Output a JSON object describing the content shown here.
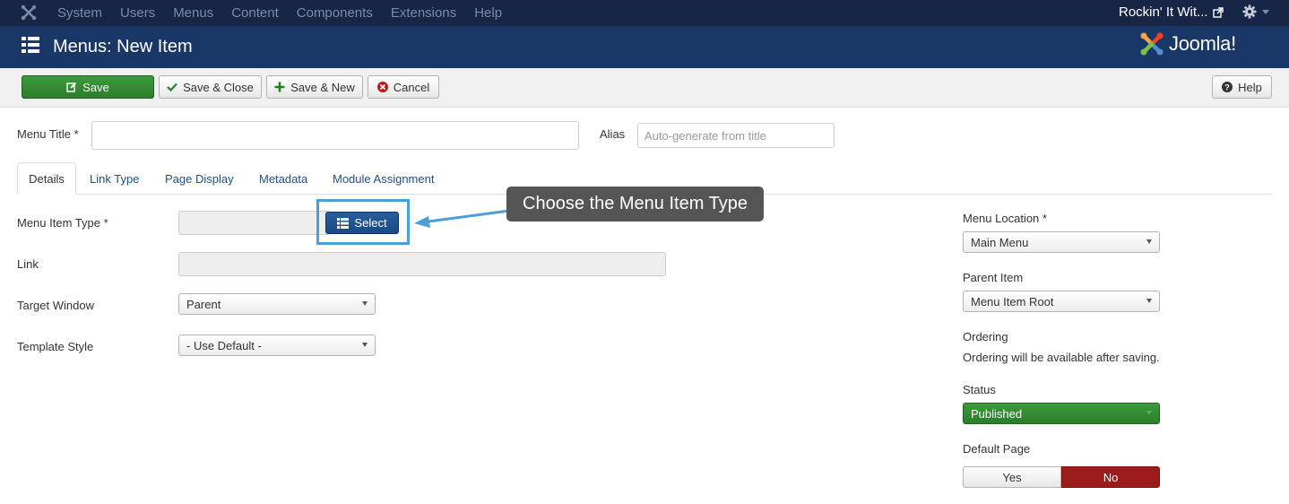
{
  "topnav": {
    "brand_icon": "joomla-icon",
    "items": [
      {
        "label": "System"
      },
      {
        "label": "Users"
      },
      {
        "label": "Menus"
      },
      {
        "label": "Content"
      },
      {
        "label": "Components"
      },
      {
        "label": "Extensions"
      },
      {
        "label": "Help"
      }
    ],
    "site_name": "Rockin' It Wit...",
    "external_icon": "external-link-icon",
    "settings_icon": "gear-icon"
  },
  "header": {
    "title": "Menus: New Item",
    "logo_text": "Joomla!"
  },
  "toolbar": {
    "save_label": "Save",
    "save_close_label": "Save & Close",
    "save_new_label": "Save & New",
    "cancel_label": "Cancel",
    "help_label": "Help"
  },
  "form": {
    "menu_title_label": "Menu Title *",
    "menu_title_value": "",
    "alias_label": "Alias",
    "alias_placeholder": "Auto-generate from title"
  },
  "tabs": [
    {
      "label": "Details",
      "active": true
    },
    {
      "label": "Link Type"
    },
    {
      "label": "Page Display"
    },
    {
      "label": "Metadata"
    },
    {
      "label": "Module Assignment"
    }
  ],
  "details": {
    "menu_item_type_label": "Menu Item Type *",
    "menu_item_type_value": "",
    "select_label": "Select",
    "link_label": "Link",
    "link_value": "",
    "target_window_label": "Target Window",
    "target_window_value": "Parent",
    "template_style_label": "Template Style",
    "template_style_value": "- Use Default -"
  },
  "callout": {
    "text": "Choose the Menu Item Type"
  },
  "sidebar": {
    "menu_location_label": "Menu Location *",
    "menu_location_value": "Main Menu",
    "parent_item_label": "Parent Item",
    "parent_item_value": "Menu Item Root",
    "ordering_label": "Ordering",
    "ordering_text": "Ordering will be available after saving.",
    "status_label": "Status",
    "status_value": "Published",
    "default_page_label": "Default Page",
    "default_yes": "Yes",
    "default_no": "No",
    "default_selected": "No"
  },
  "colors": {
    "topnav_bg": "#172547",
    "header_bg": "#1a3867",
    "save_green": "#2f8632",
    "select_blue": "#1e508e",
    "no_red": "#9c1c1c",
    "highlight_blue": "#4a9fd6",
    "callout_bg": "#555555"
  }
}
